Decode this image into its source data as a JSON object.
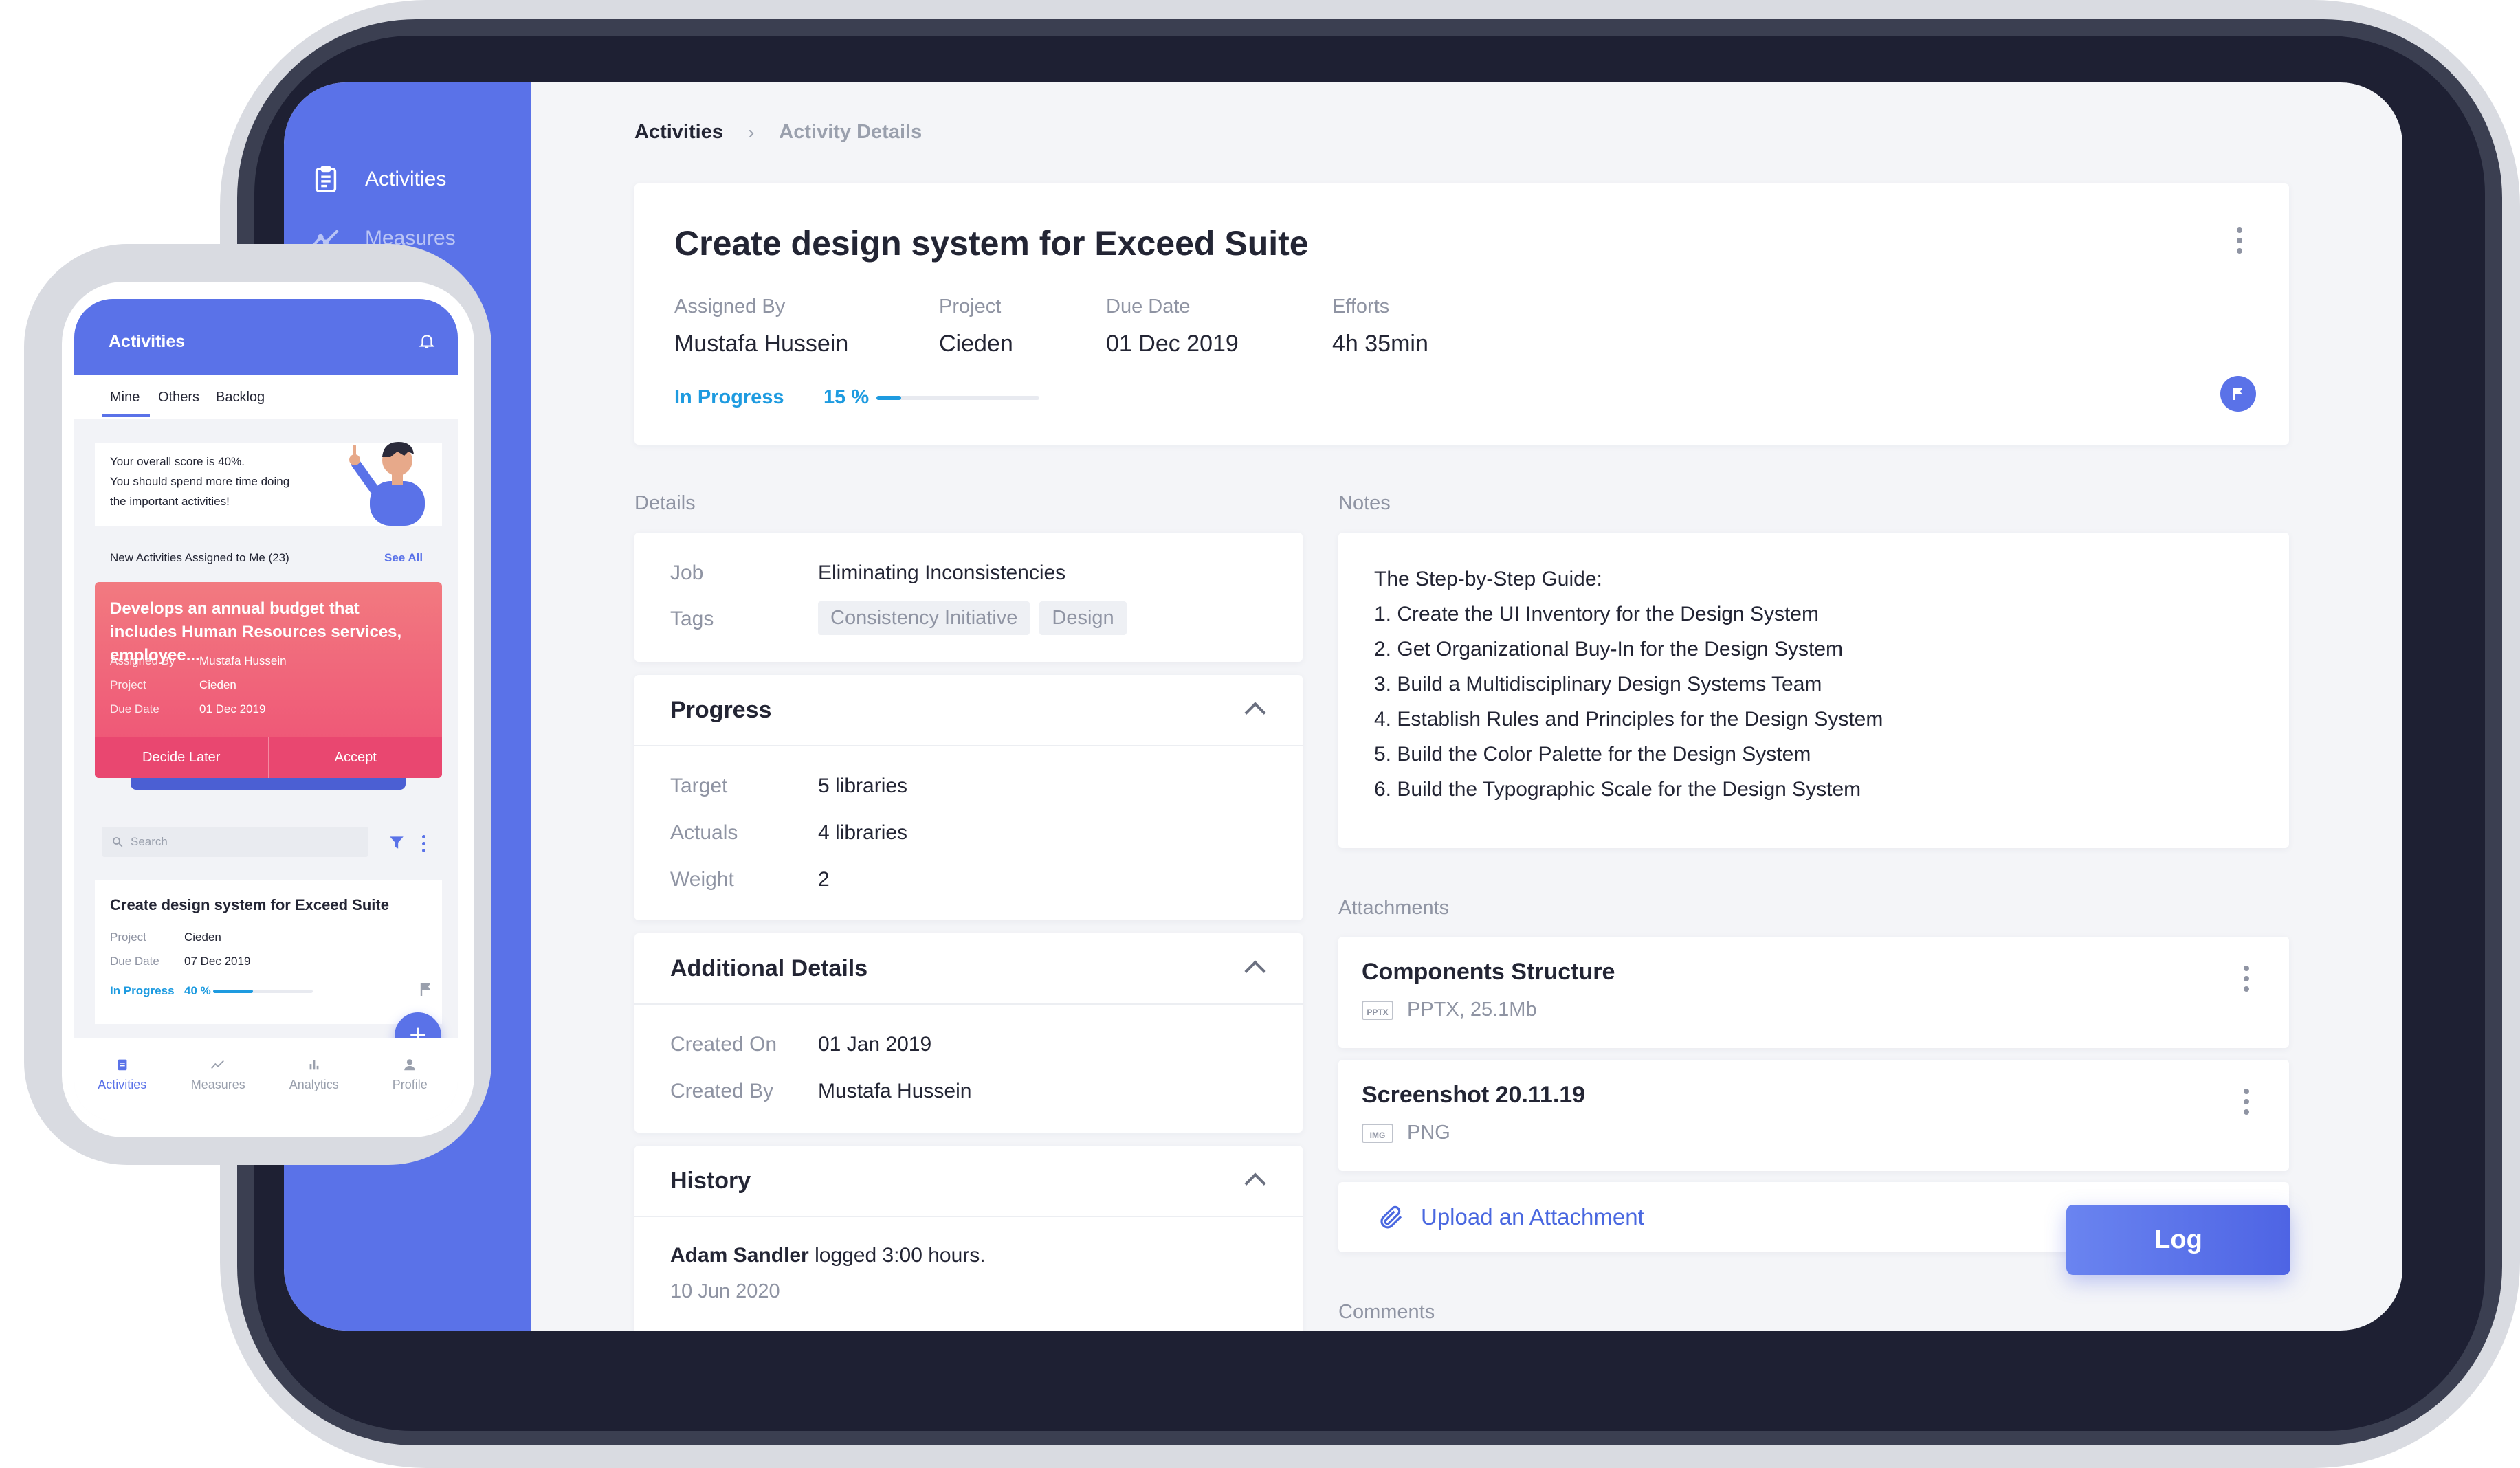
{
  "sidebar": {
    "items": [
      {
        "label": "Activities",
        "icon": "clipboard-icon"
      },
      {
        "label": "Measures",
        "icon": "trend-line-icon"
      }
    ]
  },
  "breadcrumb": {
    "root": "Activities",
    "current": "Activity Details"
  },
  "activity": {
    "title": "Create design system for Exceed Suite",
    "meta": [
      {
        "label": "Assigned By",
        "value": "Mustafa Hussein"
      },
      {
        "label": "Project",
        "value": "Cieden"
      },
      {
        "label": "Due Date",
        "value": "01 Dec 2019"
      },
      {
        "label": "Efforts",
        "value": "4h 35min"
      }
    ],
    "status": "In Progress",
    "progress_text": "15 %",
    "progress_fraction": 0.15
  },
  "details": {
    "section_label": "Details",
    "job_label": "Job",
    "job_value": "Eliminating Inconsistencies",
    "tags_label": "Tags",
    "tags": [
      "Consistency Initiative",
      "Design"
    ]
  },
  "progress_panel": {
    "title": "Progress",
    "rows": [
      {
        "label": "Target",
        "value": "5 libraries"
      },
      {
        "label": "Actuals",
        "value": "4 libraries"
      },
      {
        "label": "Weight",
        "value": "2"
      }
    ]
  },
  "additional": {
    "title": "Additional Details",
    "rows": [
      {
        "label": "Created On",
        "value": "01 Jan 2019"
      },
      {
        "label": "Created By",
        "value": "Mustafa Hussein"
      }
    ]
  },
  "history": {
    "title": "History",
    "entry_user": "Adam Sandler",
    "entry_text": "logged 3:00 hours.",
    "entry_date": "10 Jun 2020"
  },
  "notes": {
    "section_label": "Notes",
    "lines": [
      "The Step-by-Step Guide:",
      "1. Create the UI Inventory for the Design System",
      "2. Get Organizational Buy-In for the Design System",
      "3. Build a Multidisciplinary Design Systems Team",
      "4. Establish Rules and Principles for the Design System",
      "5. Build the Color Palette for the Design System",
      "6. Build the Typographic Scale for the Design System"
    ]
  },
  "attachments": {
    "section_label": "Attachments",
    "items": [
      {
        "name": "Components Structure",
        "meta": "PPTX, 25.1Mb",
        "badge": "PPTX"
      },
      {
        "name": "Screenshot 20.11.19",
        "meta": "PNG",
        "badge": "IMG"
      }
    ],
    "upload_label": "Upload an Attachment"
  },
  "comments_label": "Comments",
  "log_button": "Log",
  "phone": {
    "title": "Activities",
    "tabs": [
      "Mine",
      "Others",
      "Backlog"
    ],
    "score_lines": [
      "Your overall score is 40%.",
      "You should spend more time doing",
      "the important activities!"
    ],
    "new_label": "New Activities Assigned to Me (23)",
    "see_all": "See All",
    "red_card": {
      "title": "Develops an annual budget that includes Human Resources services, employee...",
      "rows": [
        {
          "label": "Assigned By",
          "value": "Mustafa Hussein"
        },
        {
          "label": "Project",
          "value": "Cieden"
        },
        {
          "label": "Due Date",
          "value": "01 Dec 2019"
        }
      ],
      "decline": "Decide Later",
      "accept": "Accept"
    },
    "search_placeholder": "Search",
    "item": {
      "title": "Create design system for Exceed Suite",
      "rows": [
        {
          "label": "Project",
          "value": "Cieden"
        },
        {
          "label": "Due Date",
          "value": "07 Dec 2019"
        }
      ],
      "status": "In Progress",
      "progress_text": "40 %",
      "progress_fraction": 0.4
    },
    "nav": [
      "Activities",
      "Measures",
      "Analytics",
      "Profile"
    ]
  },
  "colors": {
    "accent": "#5a72e8",
    "status_blue": "#1e9be0",
    "alert_red": "#ee5075"
  }
}
